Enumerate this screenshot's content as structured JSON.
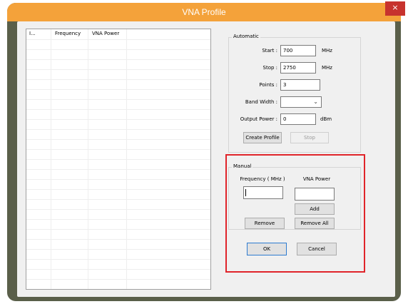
{
  "window": {
    "title": "VNA Profile",
    "close_glyph": "×"
  },
  "list": {
    "columns": [
      "I...",
      "Frequency",
      "VNA Power"
    ],
    "rows": []
  },
  "automatic": {
    "label": "Automatic",
    "start_label": "Start :",
    "start_value": "700",
    "start_unit": "MHz",
    "stop_label": "Stop :",
    "stop_value": "2750",
    "stop_unit": "MHz",
    "points_label": "Points :",
    "points_value": "3",
    "bandwidth_label": "Band Width :",
    "bandwidth_value": "",
    "output_power_label": "Output Power :",
    "output_power_value": "0",
    "output_power_unit": "dBm",
    "create_profile_label": "Create Profile",
    "stop_button_label": "Stop"
  },
  "manual": {
    "label": "Manual",
    "frequency_label": "Frequency ( MHz )",
    "frequency_value": "",
    "vna_power_label": "VNA Power",
    "vna_power_value": "",
    "add_label": "Add",
    "remove_label": "Remove",
    "remove_all_label": "Remove All"
  },
  "footer": {
    "ok_label": "OK",
    "cancel_label": "Cancel"
  },
  "colors": {
    "titlebar": "#f4a23a",
    "frame": "#5a5f4a",
    "highlight": "#e0242a",
    "close": "#c7332e"
  }
}
